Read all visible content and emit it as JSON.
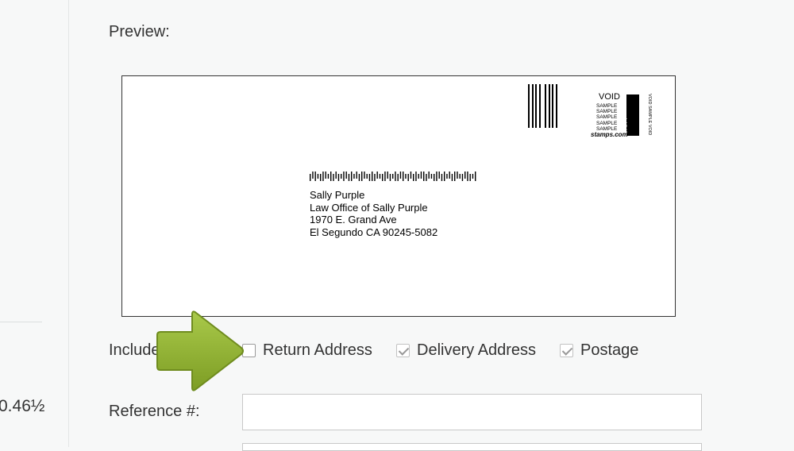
{
  "left": {
    "amount": "0.46½"
  },
  "preview": {
    "label": "Preview:"
  },
  "envelope": {
    "stamp": {
      "void_top": "VOID",
      "samples": [
        "SAMPLE",
        "SAMPLE",
        "SAMPLE",
        "SAMPLE",
        "SAMPLE"
      ],
      "block_text": "VOID",
      "side_text": "VOID SAMPLE VOID",
      "brand": "stamps.com"
    },
    "address": {
      "line1": "Sally Purple",
      "line2": "Law Office of Sally Purple",
      "line3": "1970 E. Grand Ave",
      "line4": "El Segundo CA 90245-5082"
    }
  },
  "include": {
    "label": "Include",
    "options": [
      {
        "label": "Return Address",
        "checked": false
      },
      {
        "label": "Delivery Address",
        "checked": true
      },
      {
        "label": "Postage",
        "checked": true
      }
    ]
  },
  "reference": {
    "label": "Reference #:",
    "value": ""
  },
  "colors": {
    "arrow": "#8fb030",
    "arrow_dark": "#6f8c1e"
  }
}
